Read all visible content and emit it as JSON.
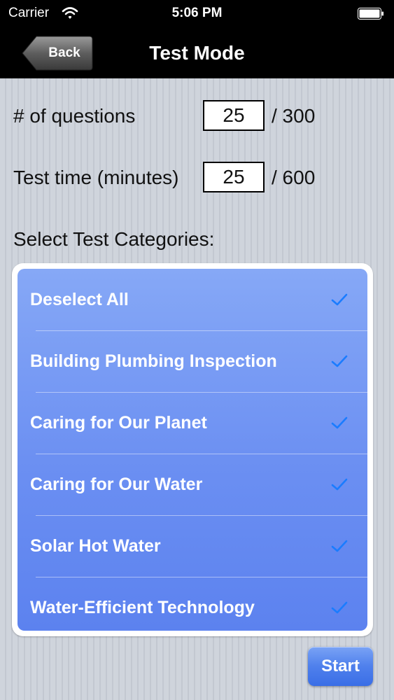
{
  "status_bar": {
    "carrier": "Carrier",
    "time": "5:06 PM",
    "wifi_icon": "wifi-icon",
    "battery_icon": "battery-icon"
  },
  "nav": {
    "back_label": "Back",
    "title": "Test Mode"
  },
  "form": {
    "questions_label": "# of questions",
    "questions_value": "25",
    "questions_max": "/ 300",
    "time_label": "Test time (minutes)",
    "time_value": "25",
    "time_max": "/ 600",
    "categories_heading": "Select Test Categories:"
  },
  "categories": [
    {
      "label": "Deselect All",
      "checked": true
    },
    {
      "label": "Building Plumbing Inspection",
      "checked": true
    },
    {
      "label": "Caring for Our Planet",
      "checked": true
    },
    {
      "label": "Caring for Our Water",
      "checked": true
    },
    {
      "label": "Solar Hot Water",
      "checked": true
    },
    {
      "label": "Water-Efficient Technology",
      "checked": true
    }
  ],
  "start_label": "Start",
  "colors": {
    "list_accent": "#6b8ff2",
    "check": "#1a7cff"
  }
}
